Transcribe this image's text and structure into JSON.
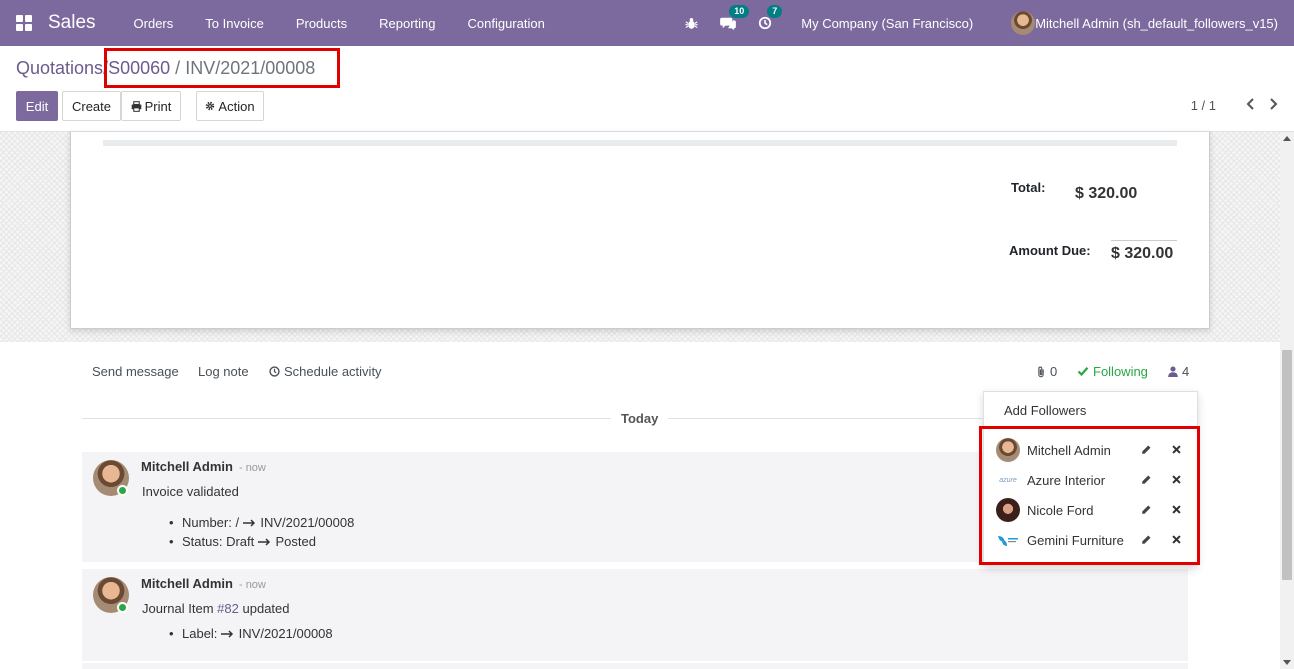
{
  "navbar": {
    "app_name": "Sales",
    "menu": [
      "Orders",
      "To Invoice",
      "Products",
      "Reporting",
      "Configuration"
    ],
    "messages_badge": "10",
    "activities_badge": "7",
    "company": "My Company (San Francisco)",
    "user": "Mitchell Admin (sh_default_followers_v15)"
  },
  "breadcrumb": {
    "root": "Quotations",
    "parent": "S00060",
    "current": "INV/2021/00008",
    "sep": "/"
  },
  "buttons": {
    "edit": "Edit",
    "create": "Create",
    "print": "Print",
    "action": "Action"
  },
  "pager": {
    "value": "1 / 1"
  },
  "totals": {
    "total_label": "Total:",
    "total_value": "$ 320.00",
    "due_label": "Amount Due:",
    "due_value": "$ 320.00"
  },
  "chatter": {
    "send_message": "Send message",
    "log_note": "Log note",
    "schedule_activity": "Schedule activity",
    "attachments": "0",
    "following": "Following",
    "followers_count": "4",
    "today": "Today",
    "messages": [
      {
        "author": "Mitchell Admin",
        "date": "- now",
        "body": "Invoice validated",
        "items": [
          {
            "label": "Number:",
            "from": "/",
            "to": "INV/2021/00008"
          },
          {
            "label": "Status:",
            "from": "Draft",
            "to": "Posted"
          }
        ]
      },
      {
        "author": "Mitchell Admin",
        "date": "- now",
        "body_prefix": "Journal Item",
        "body_link": "#82",
        "body_suffix": "updated",
        "items": [
          {
            "label": "Label:",
            "from": "",
            "to": "INV/2021/00008"
          }
        ]
      }
    ]
  },
  "followers_dropdown": {
    "add_followers": "Add Followers",
    "followers": [
      {
        "name": "Mitchell Admin"
      },
      {
        "name": "Azure Interior",
        "logo_text": "azure"
      },
      {
        "name": "Nicole Ford"
      },
      {
        "name": "Gemini Furniture"
      }
    ]
  },
  "colors": {
    "brand": "#7c6a9e",
    "badge": "#017e84",
    "following": "#28a745",
    "highlight": "#e00000"
  }
}
